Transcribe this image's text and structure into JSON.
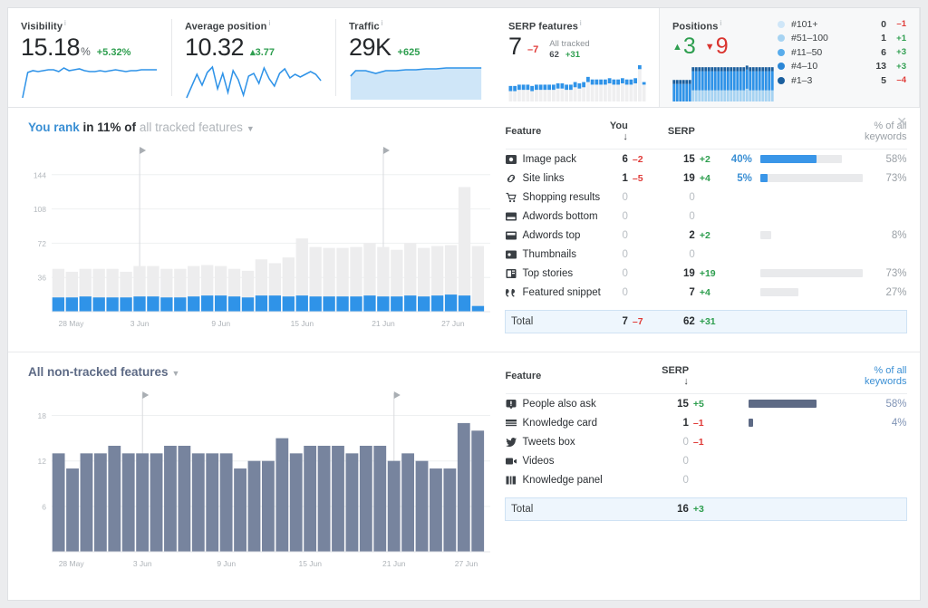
{
  "kpis": {
    "visibility": {
      "title": "Visibility",
      "value": "15.18",
      "unit": "%",
      "delta": "+5.32%",
      "delta_dir": "up"
    },
    "average_position": {
      "title": "Average position",
      "value": "10.32",
      "delta": "▴3.77",
      "delta_dir": "up"
    },
    "traffic": {
      "title": "Traffic",
      "value": "29K",
      "delta": "+625",
      "delta_dir": "up"
    },
    "serp_features": {
      "title": "SERP features",
      "value": "7",
      "delta": "–7",
      "delta_dir": "down",
      "all_tracked_label": "All tracked",
      "all_tracked_value": "62",
      "all_tracked_delta": "+31"
    },
    "positions": {
      "title": "Positions",
      "up_value": "3",
      "down_value": "9",
      "legend": [
        {
          "label": "#101+",
          "count": "0",
          "delta": "–1",
          "dir": "down",
          "color": "#cfe6f8"
        },
        {
          "label": "#51–100",
          "count": "1",
          "delta": "+1",
          "dir": "up",
          "color": "#a6d3f2"
        },
        {
          "label": "#11–50",
          "count": "6",
          "delta": "+3",
          "dir": "up",
          "color": "#58aceb"
        },
        {
          "label": "#4–10",
          "count": "13",
          "delta": "+3",
          "dir": "up",
          "color": "#2a86d6"
        },
        {
          "label": "#1–3",
          "count": "5",
          "delta": "–4",
          "dir": "down",
          "color": "#1b5f9e"
        }
      ]
    }
  },
  "tracked_section": {
    "heading_blue": "You rank",
    "heading_dark": "in 11% of",
    "heading_gray": "all tracked features",
    "close_icon": "✕",
    "columns": {
      "feature": "Feature",
      "you": "You ↓",
      "serp": "SERP",
      "pct": "% of all keywords"
    },
    "rows": [
      {
        "icon": "image-pack-icon",
        "name": "Image pack",
        "you": "6",
        "you_delta": "–2",
        "you_dir": "down",
        "serp": "15",
        "serp_delta": "+2",
        "serp_dir": "up",
        "you_pct": "40%",
        "you_pct_val": 40,
        "all_pct": "58%",
        "all_pct_val": 58
      },
      {
        "icon": "site-links-icon",
        "name": "Site links",
        "you": "1",
        "you_delta": "–5",
        "you_dir": "down",
        "serp": "19",
        "serp_delta": "+4",
        "serp_dir": "up",
        "you_pct": "5%",
        "you_pct_val": 5,
        "all_pct": "73%",
        "all_pct_val": 73
      },
      {
        "icon": "shopping-cart-icon",
        "name": "Shopping results",
        "you": "0",
        "you_delta": "",
        "you_dir": "",
        "serp": "0",
        "serp_delta": "",
        "serp_dir": "",
        "you_pct": "",
        "you_pct_val": 0,
        "all_pct": "",
        "all_pct_val": 0
      },
      {
        "icon": "adwords-bottom-icon",
        "name": "Adwords bottom",
        "you": "0",
        "you_delta": "",
        "you_dir": "",
        "serp": "0",
        "serp_delta": "",
        "serp_dir": "",
        "you_pct": "",
        "you_pct_val": 0,
        "all_pct": "",
        "all_pct_val": 0
      },
      {
        "icon": "adwords-top-icon",
        "name": "Adwords top",
        "you": "0",
        "you_delta": "",
        "you_dir": "",
        "serp": "2",
        "serp_delta": "+2",
        "serp_dir": "up",
        "you_pct": "",
        "you_pct_val": 0,
        "all_pct": "8%",
        "all_pct_val": 8
      },
      {
        "icon": "thumbnails-icon",
        "name": "Thumbnails",
        "you": "0",
        "you_delta": "",
        "you_dir": "",
        "serp": "0",
        "serp_delta": "",
        "serp_dir": "",
        "you_pct": "",
        "you_pct_val": 0,
        "all_pct": "",
        "all_pct_val": 0
      },
      {
        "icon": "top-stories-icon",
        "name": "Top stories",
        "you": "0",
        "you_delta": "",
        "you_dir": "",
        "serp": "19",
        "serp_delta": "+19",
        "serp_dir": "up",
        "you_pct": "",
        "you_pct_val": 0,
        "all_pct": "73%",
        "all_pct_val": 73
      },
      {
        "icon": "featured-snippet-icon",
        "name": "Featured snippet",
        "you": "0",
        "you_delta": "",
        "you_dir": "",
        "serp": "7",
        "serp_delta": "+4",
        "serp_dir": "up",
        "you_pct": "",
        "you_pct_val": 0,
        "all_pct": "27%",
        "all_pct_val": 27
      }
    ],
    "total": {
      "label": "Total",
      "you": "7",
      "you_delta": "–7",
      "serp": "62",
      "serp_delta": "+31"
    }
  },
  "nontracked_section": {
    "heading": "All non-tracked features",
    "columns": {
      "feature": "Feature",
      "serp": "SERP ↓",
      "pct": "% of all keywords"
    },
    "rows": [
      {
        "icon": "people-also-ask-icon",
        "name": "People also ask",
        "serp": "15",
        "serp_delta": "+5",
        "serp_dir": "up",
        "all_pct": "58%",
        "all_pct_val": 58
      },
      {
        "icon": "knowledge-card-icon",
        "name": "Knowledge card",
        "serp": "1",
        "serp_delta": "–1",
        "serp_dir": "down",
        "all_pct": "4%",
        "all_pct_val": 4
      },
      {
        "icon": "tweets-box-icon",
        "name": "Tweets box",
        "serp": "0",
        "serp_delta": "–1",
        "serp_dir": "down",
        "all_pct": "",
        "all_pct_val": 0
      },
      {
        "icon": "videos-icon",
        "name": "Videos",
        "serp": "0",
        "serp_delta": "",
        "serp_dir": "",
        "all_pct": "",
        "all_pct_val": 0
      },
      {
        "icon": "knowledge-panel-icon",
        "name": "Knowledge panel",
        "serp": "0",
        "serp_delta": "",
        "serp_dir": "",
        "all_pct": "",
        "all_pct_val": 0
      }
    ],
    "total": {
      "label": "Total",
      "serp": "16",
      "serp_delta": "+3"
    }
  },
  "chart_data": [
    {
      "type": "bar",
      "name": "tracked-features-chart",
      "title": "",
      "xlabel": "",
      "ylabel": "",
      "ylim": [
        0,
        160
      ],
      "yticks": [
        36,
        72,
        108,
        144
      ],
      "grid": true,
      "x_tick_labels": [
        "28 May",
        "3 Jun",
        "9 Jun",
        "15 Jun",
        "21 Jun",
        "27 Jun"
      ],
      "x_tick_indices": [
        0,
        6,
        12,
        18,
        24,
        30
      ],
      "annotations": [
        {
          "index": 6,
          "marker": "flag"
        },
        {
          "index": 24,
          "marker": "flag"
        }
      ],
      "series": [
        {
          "name": "SERP",
          "color": "#ededee",
          "values": [
            45,
            42,
            45,
            45,
            45,
            42,
            48,
            48,
            45,
            45,
            48,
            49,
            48,
            45,
            43,
            55,
            51,
            57,
            77,
            68,
            67,
            67,
            68,
            72,
            68,
            65,
            72,
            67,
            69,
            70,
            131,
            69
          ]
        },
        {
          "name": "You",
          "color": "#2f93e8",
          "values": [
            15,
            15,
            16,
            15,
            15,
            15,
            16,
            16,
            15,
            15,
            16,
            17,
            17,
            16,
            15,
            17,
            17,
            16,
            17,
            16,
            16,
            16,
            16,
            17,
            16,
            16,
            17,
            16,
            17,
            18,
            17,
            6
          ]
        }
      ]
    },
    {
      "type": "bar",
      "name": "non-tracked-features-chart",
      "title": "",
      "xlabel": "",
      "ylabel": "",
      "ylim": [
        0,
        19.5
      ],
      "yticks": [
        6,
        12,
        18
      ],
      "grid": true,
      "x_tick_labels": [
        "28 May",
        "3 Jun",
        "9 Jun",
        "15 Jun",
        "21 Jun",
        "27 Jun"
      ],
      "x_tick_indices": [
        0,
        6,
        12,
        18,
        24,
        30
      ],
      "annotations": [
        {
          "index": 6,
          "marker": "flag"
        },
        {
          "index": 24,
          "marker": "flag"
        }
      ],
      "series": [
        {
          "name": "SERP",
          "color": "#77849e",
          "values": [
            13,
            11,
            13,
            13,
            14,
            13,
            13,
            13,
            14,
            14,
            13,
            13,
            13,
            11,
            12,
            12,
            15,
            13,
            14,
            14,
            14,
            13,
            14,
            14,
            12,
            13,
            12,
            11,
            11,
            17,
            16
          ]
        }
      ]
    },
    {
      "type": "line",
      "name": "visibility-sparkline",
      "values": [
        1,
        12,
        13,
        12.5,
        13,
        13.5,
        13.5,
        13,
        14.5,
        13.5,
        14,
        14.5,
        13.5,
        13,
        13,
        13.5,
        13,
        13.5,
        14,
        13.5,
        13,
        13.5,
        13.8,
        14,
        14,
        14,
        14
      ],
      "color": "#2f93e8"
    },
    {
      "type": "line",
      "name": "average-position-sparkline",
      "values": [
        1,
        5,
        8,
        5,
        9,
        11,
        4,
        9,
        3,
        10,
        7,
        2,
        8,
        9,
        6,
        11,
        7,
        5,
        9,
        11,
        8,
        9,
        8,
        9,
        10,
        9,
        7
      ],
      "color": "#2f93e8"
    },
    {
      "type": "area",
      "name": "traffic-sparkline",
      "values": [
        11,
        12,
        12,
        11.5,
        12,
        12,
        12,
        12.2,
        12,
        12,
        12.2,
        12.3,
        12.5,
        12.5,
        12.4,
        12.5,
        12.6,
        12.6,
        12.6,
        12.6,
        12.6,
        12.6,
        12.6,
        12.6,
        12.6
      ],
      "color": "#2f93e8",
      "fill": "#cfe6f8"
    },
    {
      "type": "bar",
      "name": "serp-features-sparkline",
      "series": [
        {
          "name": "all-tracked",
          "color": "#efeff0",
          "values": [
            8,
            8,
            9,
            9,
            9,
            8,
            9,
            9,
            9,
            9,
            9,
            10,
            10,
            9,
            9,
            11,
            10,
            11,
            15,
            13,
            13,
            13,
            13,
            14,
            13,
            13,
            14,
            13,
            13,
            14,
            25,
            13
          ]
        },
        {
          "name": "you",
          "color": "#2f93e8",
          "values": [
            4,
            4,
            4,
            4,
            4,
            4,
            4,
            4,
            4,
            4,
            4,
            4,
            4,
            4,
            4,
            4,
            4,
            4,
            4,
            4,
            4,
            4,
            4,
            4,
            4,
            4,
            4,
            4,
            4,
            4,
            4,
            2
          ]
        }
      ]
    },
    {
      "type": "bar",
      "name": "positions-stacked-chart",
      "series": [
        {
          "name": "#101+ / #51-100",
          "color": "#a6d3f2",
          "values": [
            0,
            0,
            0,
            0,
            0,
            0,
            14,
            14,
            14,
            14,
            14,
            14,
            14,
            14,
            14,
            14,
            14,
            14,
            14,
            14,
            14,
            14,
            14,
            16,
            14,
            14,
            14,
            14,
            14,
            14,
            14,
            14
          ]
        },
        {
          "name": "#11-50 / #4-10",
          "color": "#2f93e8",
          "values": [
            22,
            22,
            22,
            22,
            22,
            22,
            24,
            24,
            24,
            24,
            24,
            24,
            24,
            24,
            24,
            24,
            24,
            24,
            24,
            24,
            24,
            24,
            24,
            24,
            24,
            24,
            24,
            24,
            24,
            24,
            24,
            24
          ]
        },
        {
          "name": "#1-3",
          "color": "#1b5f9e",
          "values": [
            5,
            5,
            5,
            5,
            5,
            5,
            5,
            5,
            5,
            5,
            5,
            5,
            5,
            5,
            5,
            5,
            5,
            5,
            5,
            5,
            5,
            5,
            5,
            5,
            5,
            5,
            5,
            5,
            5,
            5,
            5,
            5
          ]
        }
      ]
    }
  ]
}
